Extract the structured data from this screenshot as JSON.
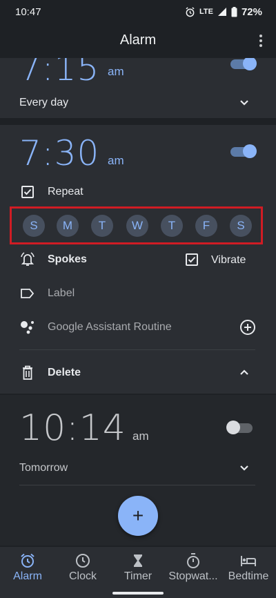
{
  "status": {
    "time": "10:47",
    "network": "LTE",
    "battery": "72%"
  },
  "app": {
    "title": "Alarm"
  },
  "alarms": [
    {
      "hour": "7:15",
      "ampm": "am",
      "repeat_text": "Every day",
      "enabled": true
    },
    {
      "hour": "7:30",
      "ampm": "am",
      "enabled": true,
      "repeat_label": "Repeat",
      "days": [
        "S",
        "M",
        "T",
        "W",
        "T",
        "F",
        "S"
      ],
      "ringtone": "Spokes",
      "vibrate_label": "Vibrate",
      "label_placeholder": "Label",
      "assistant_routine": "Google Assistant Routine",
      "delete_label": "Delete"
    },
    {
      "hour": "10:14",
      "ampm": "am",
      "repeat_text": "Tomorrow",
      "enabled": false
    }
  ],
  "fab": {
    "symbol": "+"
  },
  "nav": [
    {
      "label": "Alarm",
      "icon": "alarm-clock-icon",
      "active": true
    },
    {
      "label": "Clock",
      "icon": "clock-icon",
      "active": false
    },
    {
      "label": "Timer",
      "icon": "hourglass-icon",
      "active": false
    },
    {
      "label": "Stopwat...",
      "icon": "stopwatch-icon",
      "active": false
    },
    {
      "label": "Bedtime",
      "icon": "bed-icon",
      "active": false
    }
  ],
  "colors": {
    "accent": "#8ab4f8",
    "highlight_border": "#d01c24",
    "background": "#1e2125",
    "card": "#2b2e33"
  }
}
